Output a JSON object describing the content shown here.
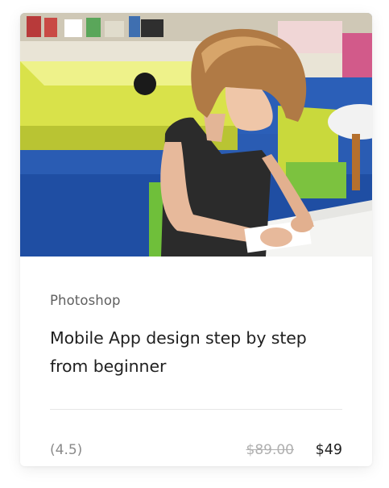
{
  "course_card": {
    "image_alt": "Child drawing at a table in a classroom",
    "category": "Photoshop",
    "title": "Mobile App design step by step from beginner",
    "rating": "(4.5)",
    "old_price": "$89.00",
    "price": "$49"
  },
  "colors": {
    "card_bg": "#ffffff",
    "title": "#1f1f1f",
    "muted": "#5f5f5f",
    "strikethrough": "#b0b0b0",
    "divider": "#e6e6e6"
  }
}
